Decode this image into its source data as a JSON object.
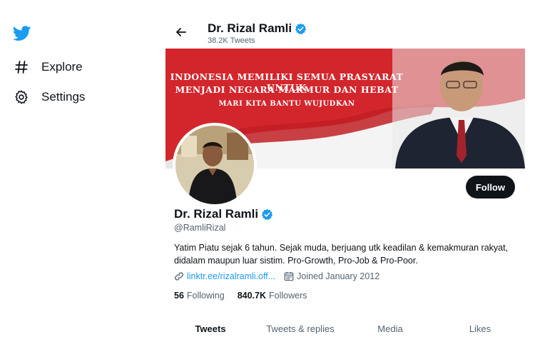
{
  "nav": {
    "logo_icon": "twitter-bird-icon",
    "items": [
      {
        "label": "Explore",
        "icon": "hashtag-icon"
      },
      {
        "label": "Settings",
        "icon": "gear-icon"
      }
    ]
  },
  "header": {
    "name": "Dr. Rizal Ramli",
    "tweets_count": "38.2K Tweets"
  },
  "banner": {
    "line1": "INDONESIA MEMILIKI SEMUA PRASYARAT UNTUK",
    "line2": "MENJADI NEGARA MAKMUR DAN HEBAT",
    "line3": "MARI KITA BANTU WUJUDKAN"
  },
  "profile": {
    "name": "Dr. Rizal Ramli",
    "handle": "@RamliRizal",
    "bio_line1": "Yatim Piatu sejak 6 tahun. Sejak muda, berjuang utk keadilan & kemakmuran rakyat,",
    "bio_line2": "didalam maupun luar sistim. Pro-Growth, Pro-Job & Pro-Poor.",
    "link": "linktr.ee/rizalramli.off...",
    "joined": "Joined January 2012",
    "following_count": "56",
    "following_label": "Following",
    "followers_count": "840.7K",
    "followers_label": "Followers",
    "follow_button": "Follow"
  },
  "tabs": [
    {
      "label": "Tweets",
      "active": true
    },
    {
      "label": "Tweets & replies",
      "active": false
    },
    {
      "label": "Media",
      "active": false
    },
    {
      "label": "Likes",
      "active": false
    }
  ],
  "colors": {
    "brand": "#1d9bf0",
    "text": "#0f1419",
    "muted": "#536471",
    "banner_red": "#d3262c"
  }
}
